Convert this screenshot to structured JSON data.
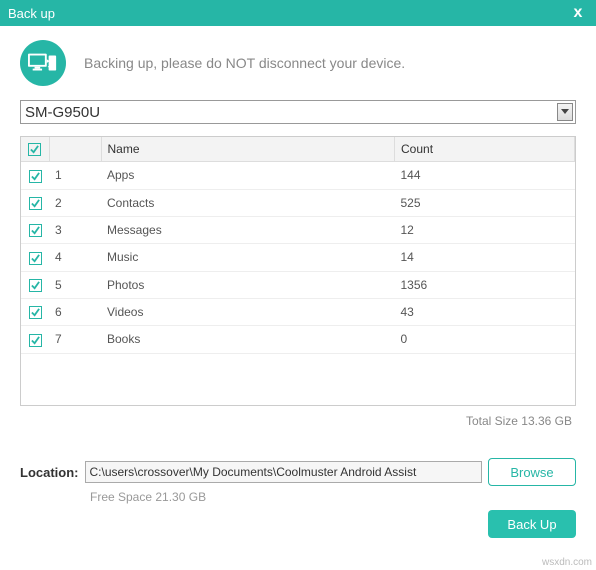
{
  "window": {
    "title": "Back up",
    "close": "x"
  },
  "status_message": "Backing up, please do NOT disconnect your device.",
  "device": {
    "selected": "SM-G950U"
  },
  "columns": {
    "num": "",
    "name": "Name",
    "count": "Count"
  },
  "items": [
    {
      "idx": "1",
      "name": "Apps",
      "count": "144",
      "checked": true
    },
    {
      "idx": "2",
      "name": "Contacts",
      "count": "525",
      "checked": true
    },
    {
      "idx": "3",
      "name": "Messages",
      "count": "12",
      "checked": true
    },
    {
      "idx": "4",
      "name": "Music",
      "count": "14",
      "checked": true
    },
    {
      "idx": "5",
      "name": "Photos",
      "count": "1356",
      "checked": true
    },
    {
      "idx": "6",
      "name": "Videos",
      "count": "43",
      "checked": true
    },
    {
      "idx": "7",
      "name": "Books",
      "count": "0",
      "checked": true
    }
  ],
  "total_size": "Total Size 13.36 GB",
  "location": {
    "label": "Location:",
    "path": "C:\\users\\crossover\\My Documents\\Coolmuster Android Assist",
    "browse": "Browse",
    "free_space": "Free Space 21.30 GB"
  },
  "backup_button": "Back Up",
  "watermark": "wsxdn.com"
}
